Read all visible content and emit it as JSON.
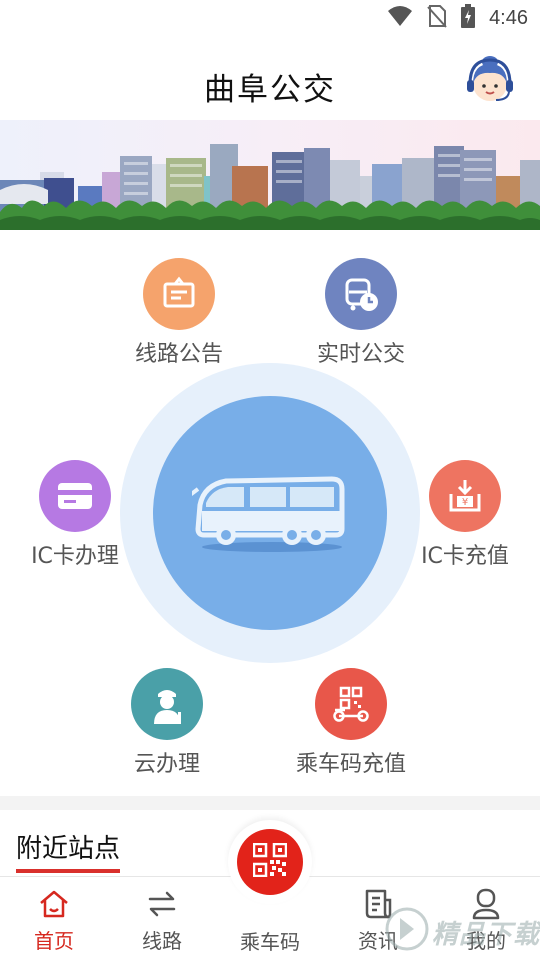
{
  "status_bar": {
    "time": "4:46",
    "icons": [
      "wifi-icon",
      "no-sim-icon",
      "battery-charging-icon"
    ]
  },
  "header": {
    "title": "曲阜公交",
    "avatar_icon": "customer-service-avatar-icon"
  },
  "banner": {
    "image": "city-skyline-illustration"
  },
  "menu": {
    "items": [
      {
        "id": "route-notice",
        "label": "线路公告",
        "icon": "notice-board-icon",
        "color": "#f5a36c"
      },
      {
        "id": "realtime-bus",
        "label": "实时公交",
        "icon": "bus-clock-icon",
        "color": "#6f84c0"
      },
      {
        "id": "ic-card-apply",
        "label": "IC卡办理",
        "icon": "card-icon",
        "color": "#b679e3"
      },
      {
        "id": "ic-card-recharge",
        "label": "IC卡充值",
        "icon": "recharge-icon",
        "color": "#ee7461"
      },
      {
        "id": "cloud-service",
        "label": "云办理",
        "icon": "person-icon",
        "color": "#4aa0a8"
      },
      {
        "id": "ride-code-recharge",
        "label": "乘车码充值",
        "icon": "qr-scooter-icon",
        "color": "#e8574a"
      }
    ],
    "center_icon": "bus-icon"
  },
  "nearby": {
    "title": "附近站点"
  },
  "bottom_nav": {
    "items": [
      {
        "id": "home",
        "label": "首页",
        "icon": "home-icon",
        "active": true
      },
      {
        "id": "routes",
        "label": "线路",
        "icon": "swap-arrows-icon",
        "active": false
      },
      {
        "id": "ride-code",
        "label": "乘车码",
        "icon": "qr-code-icon",
        "active": false
      },
      {
        "id": "news",
        "label": "资讯",
        "icon": "document-icon",
        "active": false
      },
      {
        "id": "mine",
        "label": "我的",
        "icon": "user-icon",
        "active": false
      }
    ],
    "active_color": "#d6281f",
    "qr_color": "#e2231a"
  },
  "watermark": {
    "text": "精品下载"
  }
}
